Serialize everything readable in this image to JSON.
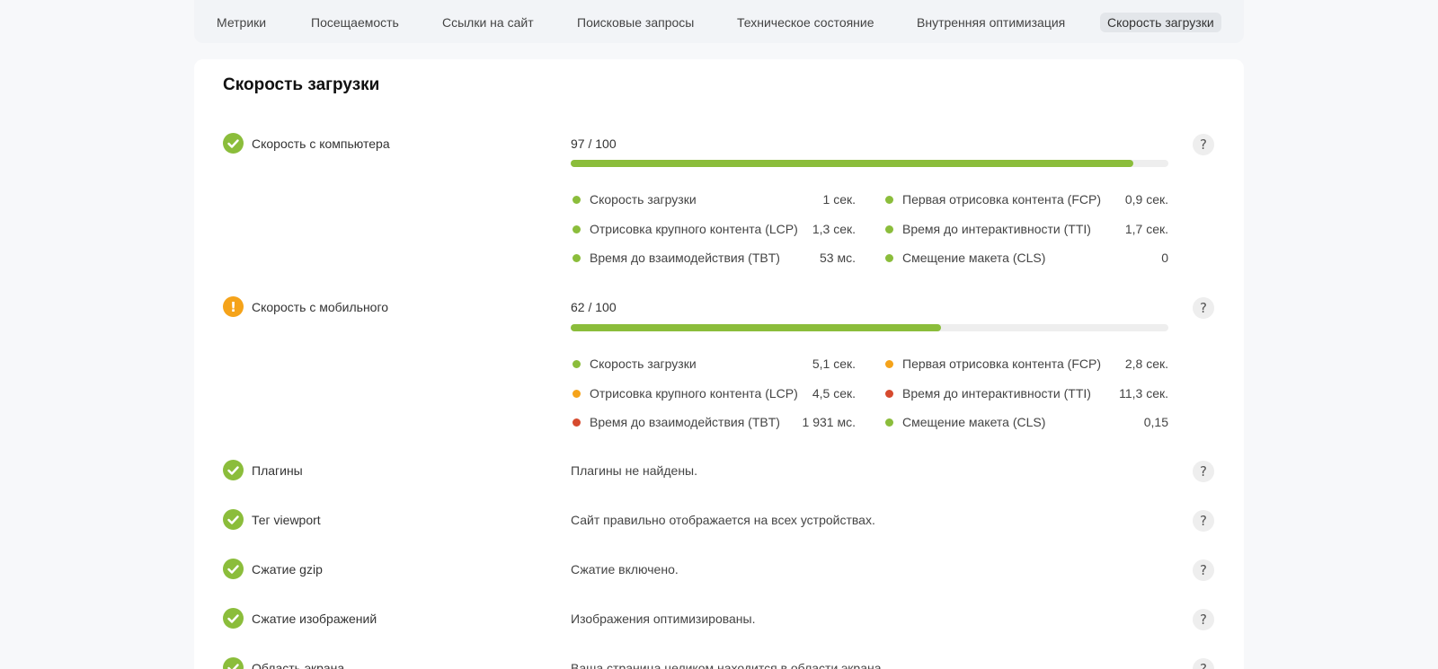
{
  "tabs": [
    {
      "label": "Метрики"
    },
    {
      "label": "Посещаемость"
    },
    {
      "label": "Ссылки на сайт"
    },
    {
      "label": "Поисковые запросы"
    },
    {
      "label": "Техническое состояние"
    },
    {
      "label": "Внутренняя оптимизация"
    },
    {
      "label": "Скорость загрузки",
      "active": true
    }
  ],
  "section": {
    "title": "Скорость загрузки",
    "help_glyph": "?",
    "warn_glyph": "!",
    "desktop": {
      "label": "Скорость с компьютера",
      "status": "ok",
      "score_text": "97 / 100",
      "score": 97,
      "score_max": 100,
      "metrics": [
        {
          "name": "Скорость загрузки",
          "value": "1 сек.",
          "status": "good"
        },
        {
          "name": "Первая отрисовка контента (FCP)",
          "value": "0,9 сек.",
          "status": "good"
        },
        {
          "name": "Отрисовка крупного контента (LCP)",
          "value": "1,3 сек.",
          "status": "good"
        },
        {
          "name": "Время до интерактивности (TTI)",
          "value": "1,7 сек.",
          "status": "good"
        },
        {
          "name": "Время до взаимодействия (TBT)",
          "value": "53 мс.",
          "status": "good"
        },
        {
          "name": "Смещение макета (CLS)",
          "value": "0",
          "status": "good"
        }
      ]
    },
    "mobile": {
      "label": "Скорость с мобильного",
      "status": "warn",
      "score_text": "62 / 100",
      "score": 62,
      "score_max": 100,
      "metrics": [
        {
          "name": "Скорость загрузки",
          "value": "5,1 сек.",
          "status": "good"
        },
        {
          "name": "Первая отрисовка контента (FCP)",
          "value": "2,8 сек.",
          "status": "average"
        },
        {
          "name": "Отрисовка крупного контента (LCP)",
          "value": "4,5 сек.",
          "status": "average"
        },
        {
          "name": "Время до интерактивности (TTI)",
          "value": "11,3 сек.",
          "status": "poor"
        },
        {
          "name": "Время до взаимодействия (TBT)",
          "value": "1 931 мс.",
          "status": "poor"
        },
        {
          "name": "Смещение макета (CLS)",
          "value": "0,15",
          "status": "good"
        }
      ]
    },
    "checks": [
      {
        "label": "Плагины",
        "description": "Плагины не найдены.",
        "status": "ok"
      },
      {
        "label": "Тег viewport",
        "description": "Сайт правильно отображается на всех устройствах.",
        "status": "ok"
      },
      {
        "label": "Сжатие gzip",
        "description": "Сжатие включено.",
        "status": "ok"
      },
      {
        "label": "Сжатие изображений",
        "description": "Изображения оптимизированы.",
        "status": "ok"
      },
      {
        "label": "Область экрана",
        "description": "Ваша страница целиком находится в области экрана.",
        "status": "ok"
      }
    ]
  },
  "colors": {
    "good": "#8bbd3b",
    "average": "#f5a31a",
    "poor": "#d64a2e",
    "bar_track": "#eeeeee"
  },
  "icons": {
    "ok": "check-circle-icon",
    "warn": "exclamation-circle-icon",
    "help": "question-mark-icon"
  }
}
